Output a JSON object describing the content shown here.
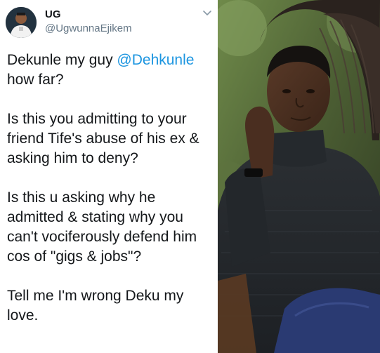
{
  "tweet": {
    "display_name": "UG",
    "handle": "@UgwunnaEjikem",
    "caret_icon": "chevron-down-icon",
    "avatar_icon": "user-avatar",
    "body": {
      "p1_prefix": "Dekunle my guy ",
      "mention": "@Dehkunle",
      "p1_suffix": " how far?",
      "p2": "Is this you admitting to your friend Tife's abuse of his ex & asking him to deny?",
      "p3": "Is this u asking why he admitted & stating why you can't vociferously defend him cos of \"gigs & jobs\"?",
      "p4": "Tell me I'm wrong Deku my love."
    },
    "colors": {
      "text": "#14171a",
      "secondary": "#657786",
      "link": "#1b95e0"
    }
  },
  "photo": {
    "subject": "young man in black turtleneck with braided-hair person behind"
  }
}
